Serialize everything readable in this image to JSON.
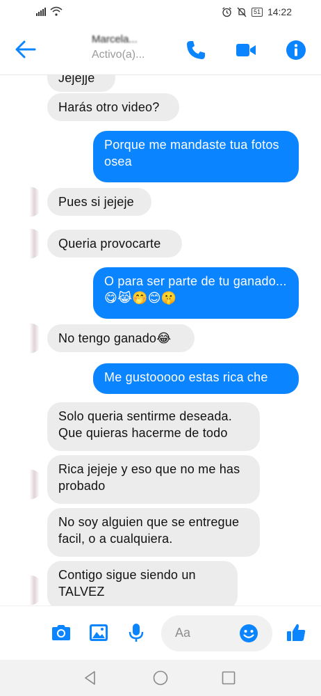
{
  "status_bar": {
    "battery": "51",
    "time": "14:22"
  },
  "header": {
    "contact_name": "Marcela...",
    "contact_status": "Activo(a)..."
  },
  "messages": [
    {
      "side": "in",
      "text": "Jejejje"
    },
    {
      "side": "in",
      "text": "Harás otro video?"
    },
    {
      "side": "out",
      "text": "Porque me mandaste tua fotos osea"
    },
    {
      "side": "in",
      "text": "Pues si jejeje"
    },
    {
      "side": "in",
      "text": "Queria provocarte"
    },
    {
      "side": "out",
      "text": "O para ser parte de tu ganado... 😋😹🤭😊🤫"
    },
    {
      "side": "in",
      "text": "No tengo ganado😂"
    },
    {
      "side": "out",
      "text": "Me gustooooo estas rica che"
    },
    {
      "side": "in",
      "text": "Solo queria sentirme deseada. Que quieras hacerme de todo"
    },
    {
      "side": "in",
      "text": "Rica jejeje y eso que no me has probado"
    },
    {
      "side": "in",
      "text": "No soy alguien que se entregue facil, o a cualquiera."
    },
    {
      "side": "in",
      "text": "Contigo sigue siendo un TALVEZ"
    }
  ],
  "composer": {
    "placeholder": "Aa"
  },
  "colors": {
    "accent": "#0b84ff",
    "incoming_bubble": "#ececec",
    "outgoing_bubble": "#0b84ff"
  }
}
